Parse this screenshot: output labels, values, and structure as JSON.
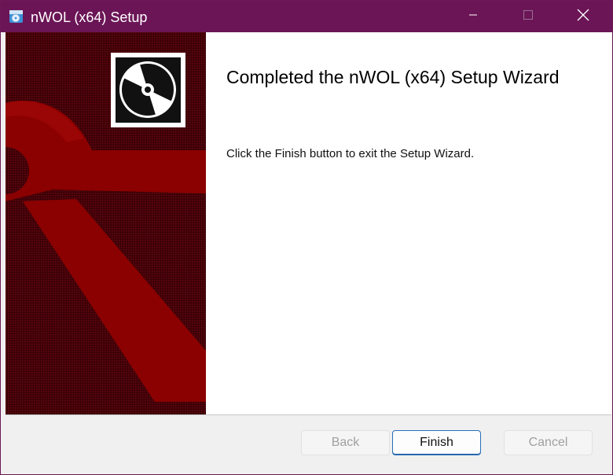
{
  "window": {
    "title": "nWOL (x64) Setup",
    "titlebar_color": "#6b1556"
  },
  "icons": {
    "app": "installer-disc-icon",
    "minimize": "minimize-icon",
    "maximize": "maximize-icon",
    "close": "close-icon",
    "banner": "cd-disc-icon"
  },
  "wizard": {
    "heading": "Completed the nWOL (x64) Setup Wizard",
    "message": "Click the Finish button to exit the Setup Wizard."
  },
  "buttons": {
    "back": "Back",
    "finish": "Finish",
    "cancel": "Cancel"
  },
  "colors": {
    "banner_dark": "#4a0008",
    "banner_red": "#8b0000",
    "accent": "#2a6fb8"
  }
}
